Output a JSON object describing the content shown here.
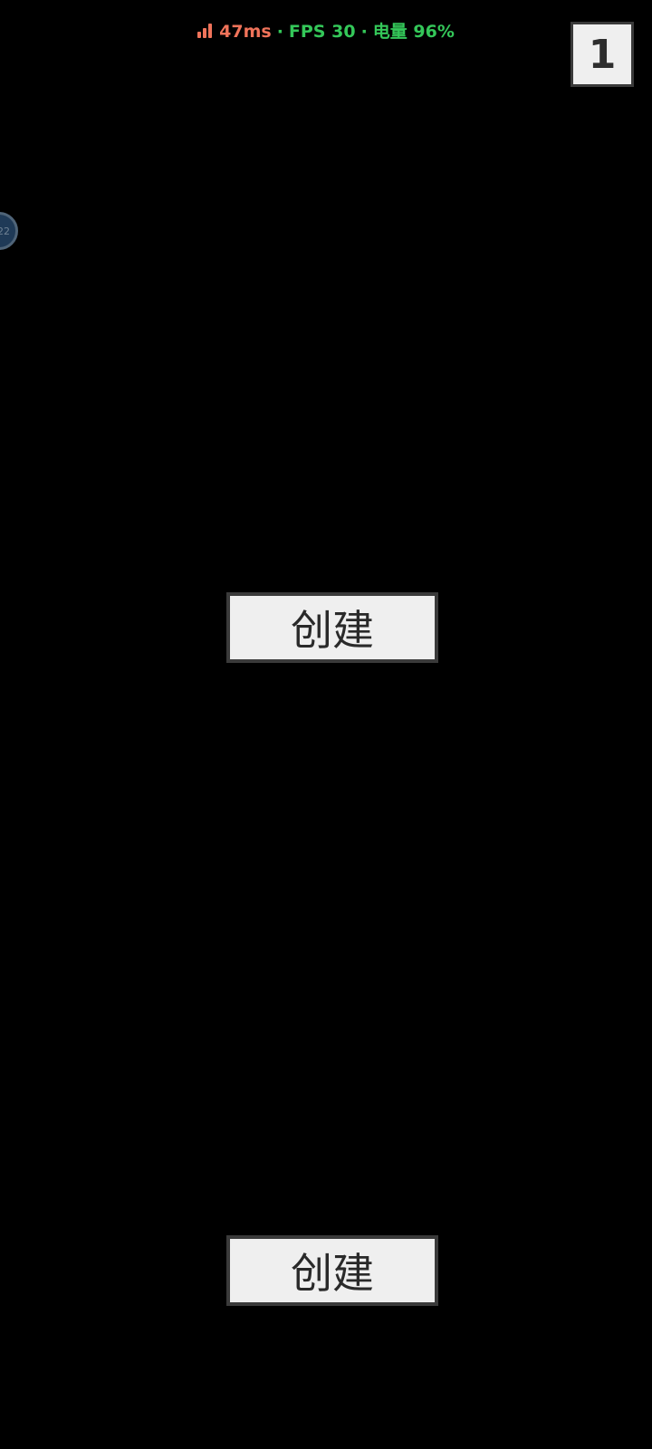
{
  "status_overlay": {
    "signal_icon": "signal-bars-icon",
    "latency": "47ms",
    "separator": "·",
    "fps": "FPS 30",
    "battery": "电量 96%",
    "colors": {
      "latency": "#f0735a",
      "stats": "#34c759"
    }
  },
  "page_counter": {
    "value": "1"
  },
  "floating_ball": {
    "label": "22"
  },
  "buttons": {
    "create_top_label": "创建",
    "create_bottom_label": "创建"
  },
  "colors": {
    "background": "#000000",
    "button_fill": "#efefef",
    "button_border": "#3a3a3a"
  }
}
